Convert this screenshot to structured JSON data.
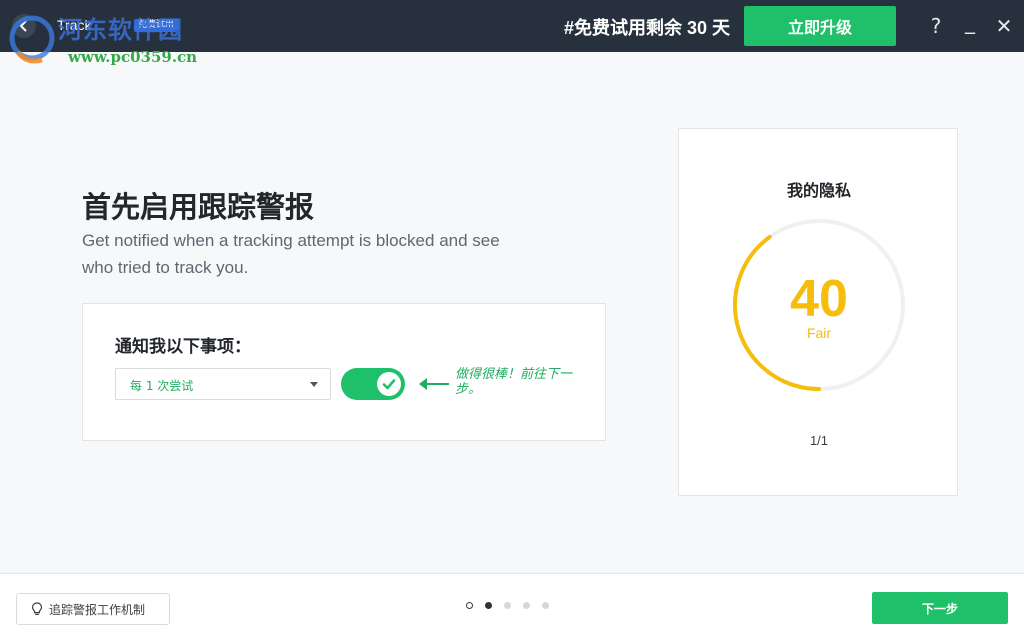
{
  "titlebar": {
    "app_name": "Track",
    "trial_badge": "免费试用",
    "trial_remaining": "#免费试用剩余 30 天",
    "upgrade_label": "立即升级",
    "help_glyph": "?",
    "minimize_glyph": "_",
    "close_glyph": "✕"
  },
  "watermark": {
    "site_name": "河东软件园",
    "url": "www.pc0359.cn"
  },
  "main": {
    "heading": "首先启用跟踪警报",
    "subtext": "Get notified when a tracking attempt is blocked and see who tried to track you.",
    "notify": {
      "title": "通知我以下事项：",
      "frequency_value": "每 1 次尝试",
      "toggle_on": true,
      "hint": "做得很棒！前往下一步。"
    }
  },
  "privacy": {
    "title": "我的隐私",
    "score": "40",
    "score_label": "Fair",
    "score_fraction": 0.4,
    "page_count": "1/1"
  },
  "footer": {
    "mechanism_label": "追踪警报工作机制",
    "dots_total": 5,
    "dots_active_index": 1,
    "next_label": "下一步"
  },
  "colors": {
    "accent_green": "#1fc06a",
    "score_yellow": "#f6bd0d",
    "titlebar_bg": "#26313d"
  },
  "icons": [
    "back-arrow-icon",
    "help-icon",
    "minimize-icon",
    "close-icon",
    "caret-down-icon",
    "checkmark-icon",
    "arrow-left-icon",
    "lightbulb-icon"
  ]
}
